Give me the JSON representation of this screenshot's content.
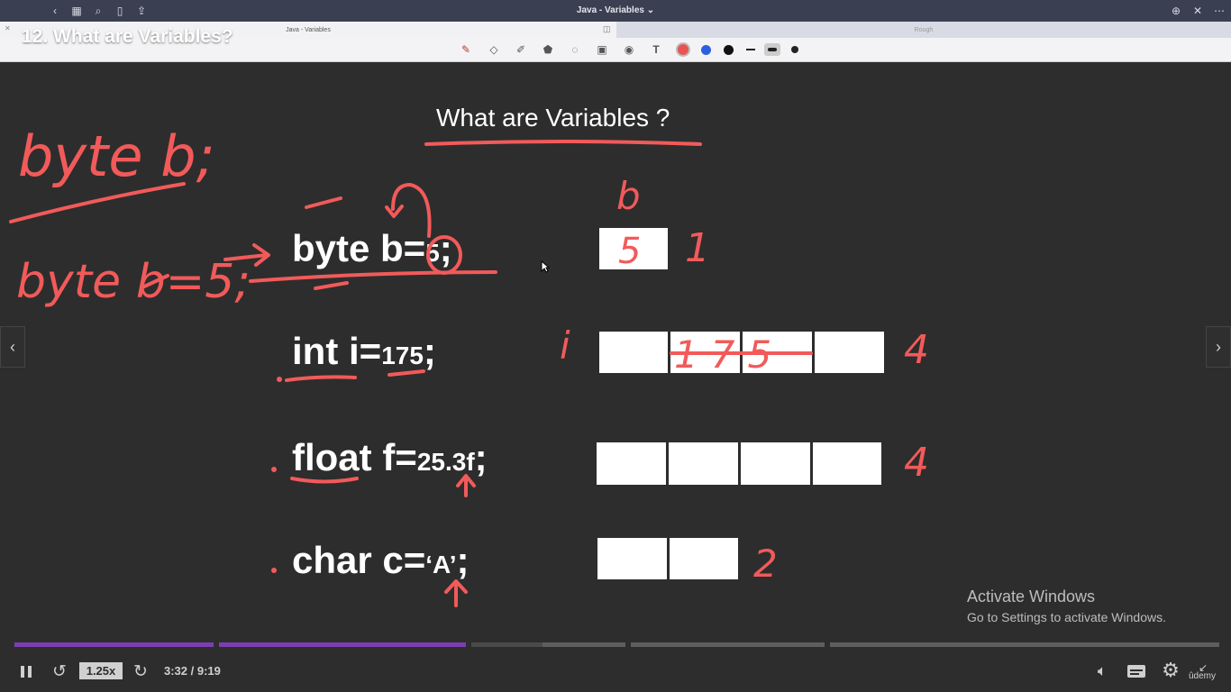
{
  "window": {
    "title": "Java - Variables ⌄"
  },
  "tabs": [
    {
      "label": "Java - Variables"
    },
    {
      "label": "Rough"
    }
  ],
  "video": {
    "title": "12. What are Variables?"
  },
  "slide": {
    "title": "What are Variables ?",
    "lines": [
      {
        "decl": "byte b=",
        "value": "5",
        "end": ";"
      },
      {
        "decl": "int i=",
        "value": "175",
        "end": ";"
      },
      {
        "decl": "float f=",
        "value": "25.3f",
        "end": ";"
      },
      {
        "decl": "char c=",
        "value": "‘A’",
        "end": ";"
      }
    ]
  },
  "annotations": {
    "left_top": "byte b;",
    "left_bottom": "byte b=5;",
    "label_b": "b",
    "label_i": "i",
    "box_value_byte": "5",
    "box_value_int": "175",
    "size_byte": "1",
    "size_int": "4",
    "size_float": "4",
    "size_char": "2"
  },
  "toolbar": {
    "colors": {
      "red": "#e85454",
      "blue": "#2f5fe0",
      "black": "#111111"
    }
  },
  "watermark": {
    "line1": "Activate Windows",
    "line2": "Go to Settings to activate Windows."
  },
  "player": {
    "speed": "1.25x",
    "time": "3:32 / 9:19",
    "progress_fraction": 0.379,
    "brand": "ûdemy",
    "accent": "#7b3fb2"
  }
}
